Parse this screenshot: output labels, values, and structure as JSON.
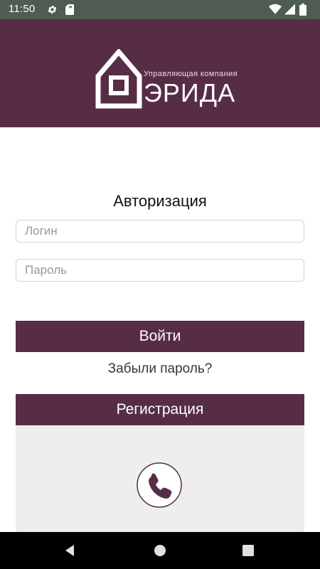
{
  "status_bar": {
    "time": "11:50",
    "icons": [
      "gear-icon",
      "sd-card-icon",
      "wifi-icon",
      "signal-icon",
      "battery-icon"
    ]
  },
  "header": {
    "logo_subtitle": "Управляющая компания",
    "logo_name": "ЭРИДА",
    "background_color": "#572d46"
  },
  "auth": {
    "title": "Авторизация",
    "login_placeholder": "Логин",
    "login_value": "",
    "password_placeholder": "Пароль",
    "password_value": "",
    "login_button": "Войти",
    "forgot_link": "Забыли пароль?",
    "register_button": "Регистрация"
  },
  "contact": {
    "icon": "phone-icon"
  },
  "nav_bar": {
    "buttons": [
      "back-icon",
      "home-icon",
      "recent-apps-icon"
    ]
  },
  "colors": {
    "accent": "#572d46",
    "status_bar": "#4e5c52",
    "panel": "#efeeee"
  }
}
